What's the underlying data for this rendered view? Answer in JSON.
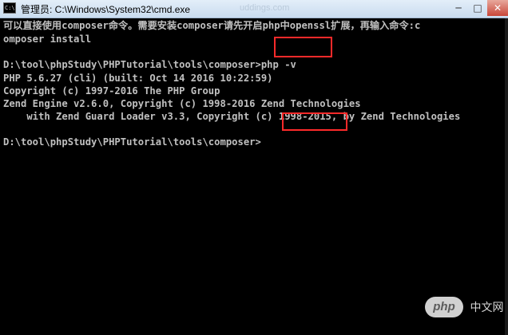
{
  "window": {
    "title": "管理员: C:\\Windows\\System32\\cmd.exe",
    "icon_label": "C:\\",
    "title_watermark": "uddings.com",
    "minimize_glyph": "─",
    "maximize_glyph": "□",
    "close_glyph": "✕"
  },
  "console": {
    "lines": [
      "可以直接使用composer命令。需要安装composer请先开启php中openssl扩展，再输入命令:c",
      "omposer install",
      "D:\\tool\\phpStudy\\PHPTutorial\\tools\\composer>php -v",
      "PHP 5.6.27 (cli) (built: Oct 14 2016 10:22:59)",
      "Copyright (c) 1997-2016 The PHP Group",
      "Zend Engine v2.6.0, Copyright (c) 1998-2016 Zend Technologies",
      "    with Zend Guard Loader v3.3, Copyright (c) 1998-2015, by Zend Technologies",
      "D:\\tool\\phpStudy\\PHPTutorial\\tools\\composer>"
    ]
  },
  "highlight_color": "#ff2a2a",
  "watermark": {
    "badge": "php",
    "text": "中文网"
  }
}
